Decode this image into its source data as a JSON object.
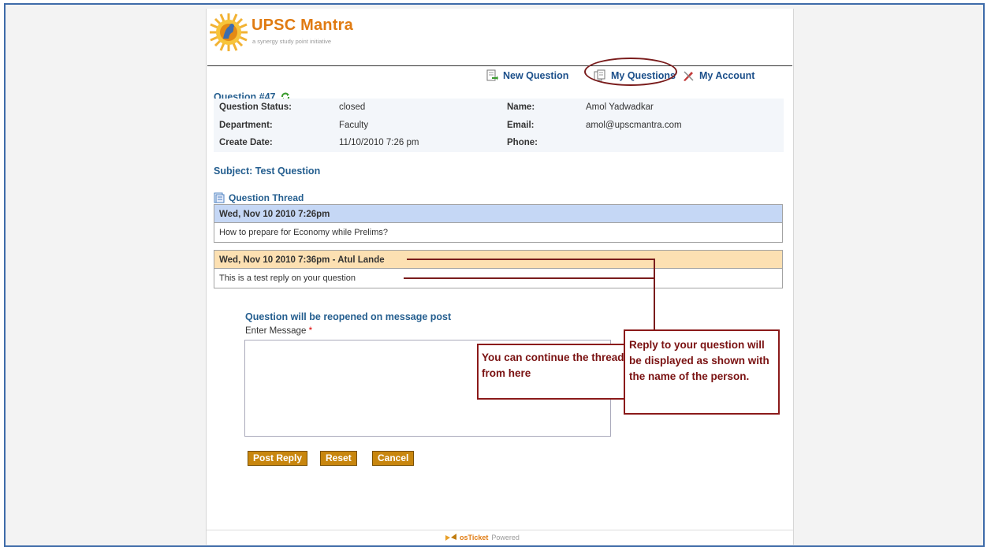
{
  "brand": {
    "name": "UPSC Mantra",
    "tagline": "a synergy study point initiative"
  },
  "nav": {
    "new_question": "New Question",
    "my_questions": "My Questions",
    "my_account": "My Account"
  },
  "question": {
    "number": "Question #47",
    "fields": {
      "status_label": "Question Status:",
      "status": "closed",
      "name_label": "Name:",
      "name": "Amol Yadwadkar",
      "department_label": "Department:",
      "department": "Faculty",
      "email_label": "Email:",
      "email": "amol@upscmantra.com",
      "create_label": "Create Date:",
      "create_date": "11/10/2010 7:26 pm",
      "phone_label": "Phone:",
      "phone": ""
    },
    "subject": "Subject: Test Question"
  },
  "thread": {
    "title": "Question Thread",
    "messages": [
      {
        "header": "Wed, Nov 10 2010 7:26pm",
        "body": "How to prepare for Economy while Prelims?",
        "color": "#c5d7f5"
      },
      {
        "header": "Wed, Nov 10 2010 7:36pm - Atul Lande",
        "body": "This is a test reply on your question",
        "color": "#fce0b2"
      }
    ]
  },
  "reply_form": {
    "notice": "Question will be reopened on message post",
    "message_label": "Enter Message",
    "required_marker": "*",
    "buttons": {
      "post": "Post Reply",
      "reset": "Reset",
      "cancel": "Cancel"
    }
  },
  "annotations": {
    "textarea_note": "You can continue the thread of discussion by replying from here",
    "reply_note": "Reply to your question will be displayed as shown with the name of the person."
  },
  "footer": {
    "brand": "osTicket",
    "suffix": "Powered"
  },
  "colors": {
    "accent": "#245e8f",
    "button": "#c8860e",
    "annotation": "#8b1a1a"
  }
}
